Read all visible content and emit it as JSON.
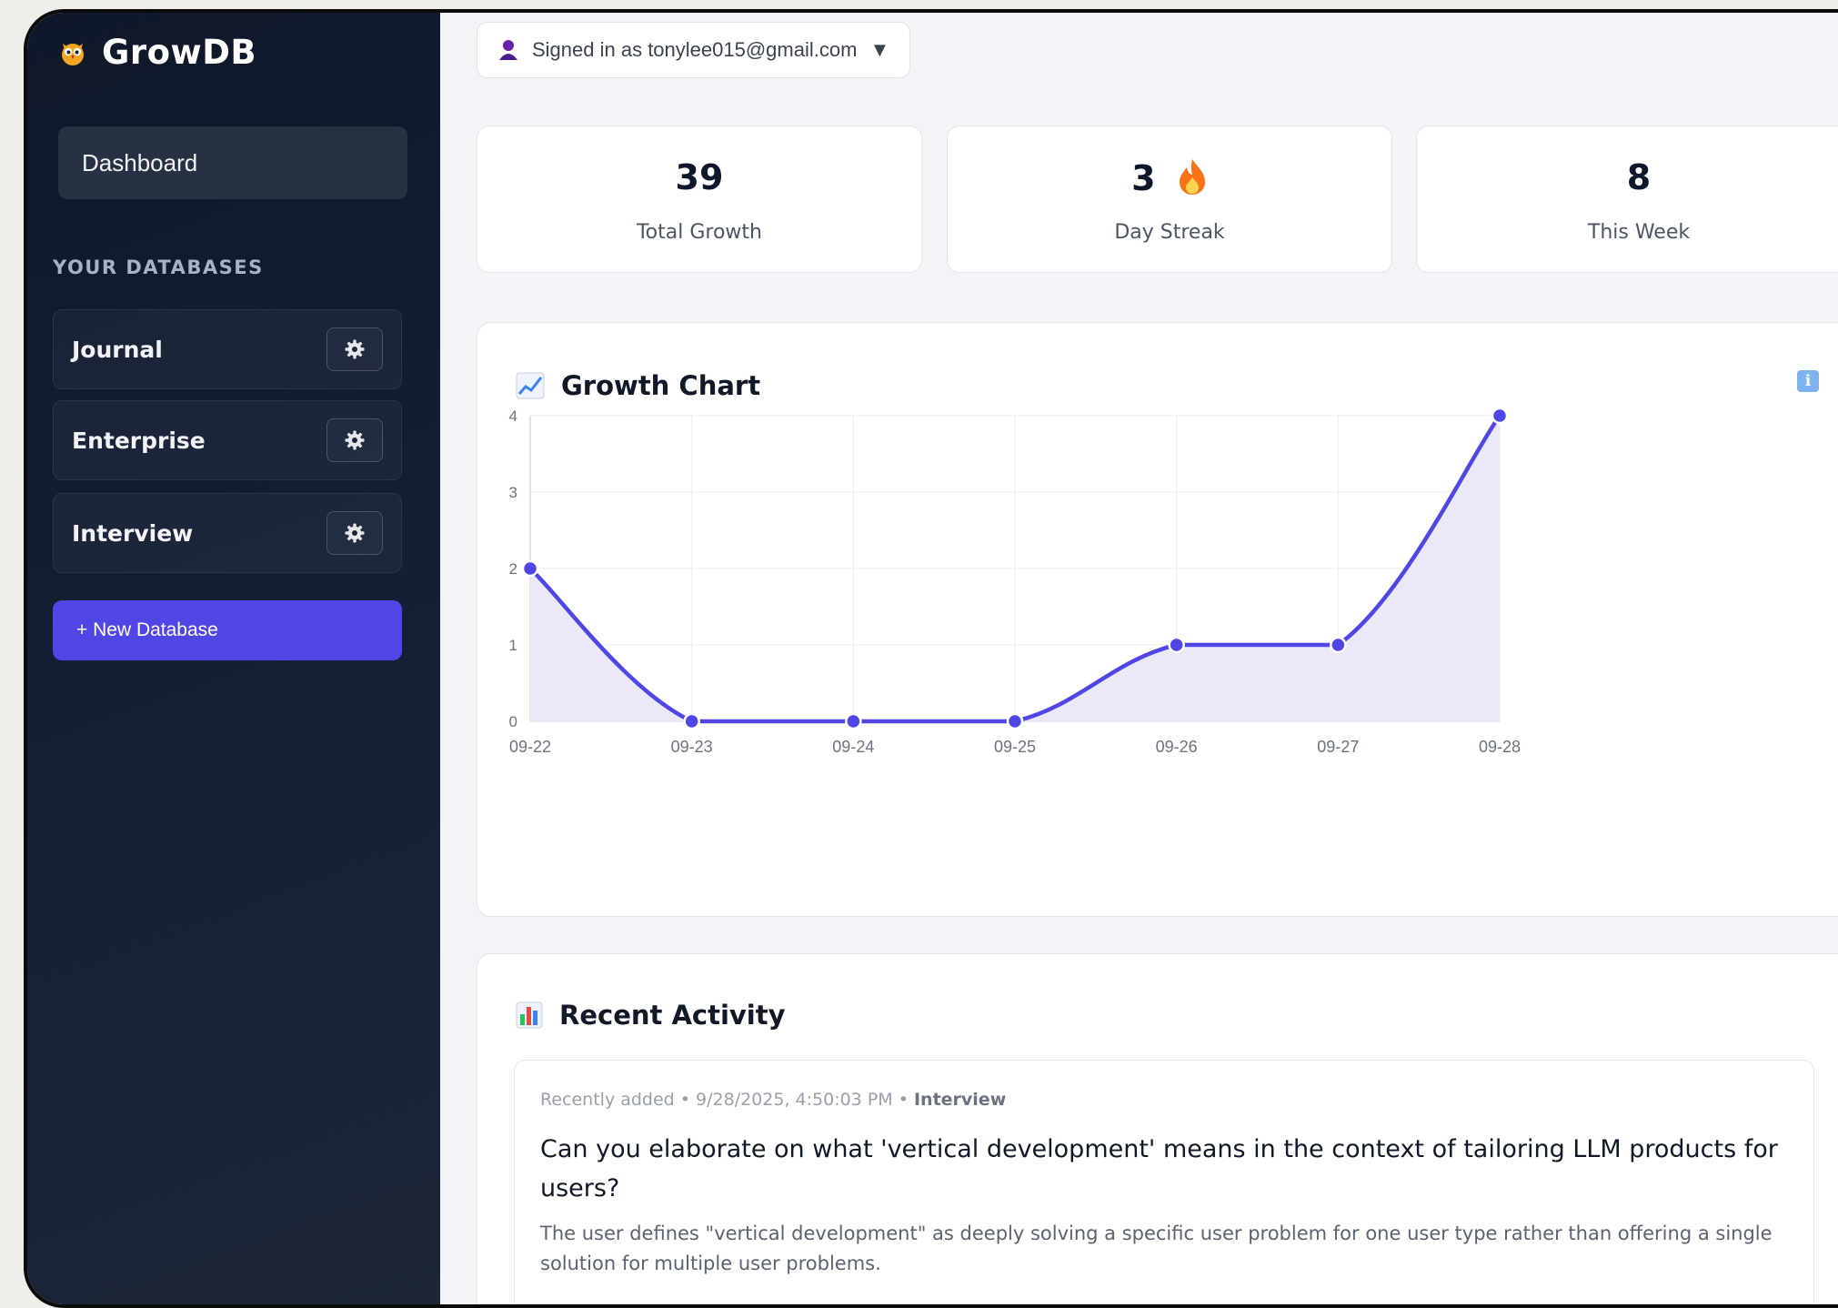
{
  "sidebar": {
    "logo_text": "GrowDB",
    "dashboard_label": "Dashboard",
    "section_heading": "YOUR DATABASES",
    "databases": [
      {
        "label": "Journal"
      },
      {
        "label": "Enterprise"
      },
      {
        "label": "Interview"
      }
    ],
    "new_database_label": "+ New Database"
  },
  "header": {
    "signed_in_text": "Signed in as tonylee015@gmail.com",
    "dropdown_arrow": "▼"
  },
  "stats": [
    {
      "value": "39",
      "label": "Total Growth"
    },
    {
      "value": "3",
      "label": "Day Streak"
    },
    {
      "value": "8",
      "label": "This Week"
    }
  ],
  "chart_card": {
    "title": "Growth Chart"
  },
  "chart_data": {
    "type": "area",
    "x": [
      "09-22",
      "09-23",
      "09-24",
      "09-25",
      "09-26",
      "09-27",
      "09-28"
    ],
    "series": [
      {
        "values": [
          2,
          0,
          0,
          0,
          1,
          1,
          4
        ]
      }
    ],
    "yticks": [
      "0",
      "1",
      "2",
      "3",
      "4"
    ],
    "ylim": [
      0,
      4
    ],
    "grid": true,
    "smooth": true,
    "color": "#4f46e5",
    "fill_color": "#ebe9f8"
  },
  "activity": {
    "title": "Recent Activity",
    "items": [
      {
        "meta_prefix": "Recently added • 9/28/2025, 4:50:03 PM •",
        "database": "Interview",
        "title": "Can you elaborate on what 'vertical development' means in the context of tailoring LLM products for users?",
        "body": "The user defines \"vertical development\" as deeply solving a specific user problem for one user type rather than offering a single solution for multiple user problems."
      }
    ]
  },
  "colors": {
    "accent": "#4f46e5",
    "sidebar_bg": "#0f1729",
    "page_bg": "#f3f4f7"
  },
  "icons": {
    "logo": "owl-icon",
    "settings": "gear-icon",
    "user": "user-icon",
    "streak": "fire-icon",
    "chart": "chart-up-icon",
    "info": "info-icon",
    "activity": "bar-chart-icon"
  }
}
